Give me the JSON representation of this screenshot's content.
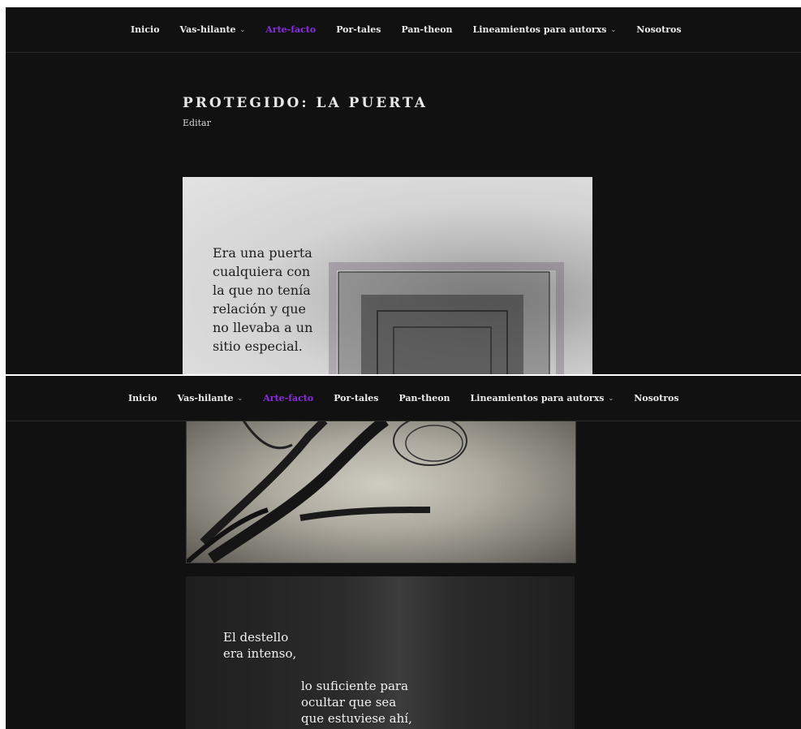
{
  "nav": {
    "items": [
      {
        "label": "Inicio",
        "has_dropdown": false,
        "active": false
      },
      {
        "label": "Vas-hilante",
        "has_dropdown": true,
        "active": false
      },
      {
        "label": "Arte-facto",
        "has_dropdown": false,
        "active": true
      },
      {
        "label": "Por-tales",
        "has_dropdown": false,
        "active": false
      },
      {
        "label": "Pan-theon",
        "has_dropdown": false,
        "active": false
      },
      {
        "label": "Lineamientos para autorxs",
        "has_dropdown": true,
        "active": false
      },
      {
        "label": "Nosotros",
        "has_dropdown": false,
        "active": false
      }
    ],
    "dropdown_icon": "chevron-down-icon",
    "active_color": "#8a2be2"
  },
  "page": {
    "title": "PROTEGIDO: LA PUERTA",
    "edit_label": "Editar"
  },
  "panels": {
    "panel_1": {
      "lines": [
        "Era una puerta",
        "cualquiera con",
        "la que no tenía",
        "relación y que",
        "no llevaba a un",
        "sitio especial."
      ]
    },
    "panel_3": {
      "lines_a": [
        "El destello",
        "era intenso,"
      ],
      "lines_b": [
        "lo suficiente para",
        "ocultar que sea",
        "que estuviese ahí,"
      ]
    }
  },
  "colors": {
    "background": "#111111",
    "nav_text": "#ececec",
    "divider": "#2b2b2b"
  }
}
